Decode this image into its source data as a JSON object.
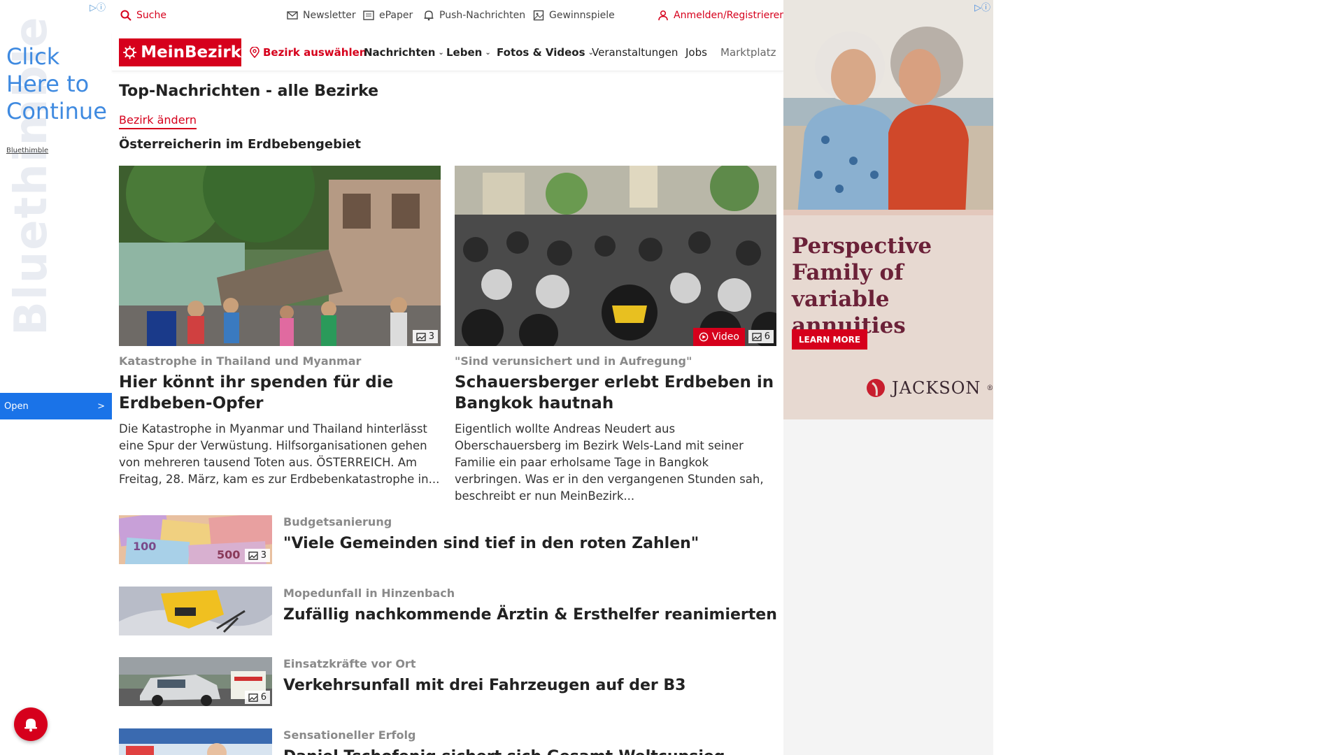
{
  "left_ad": {
    "bg_brand": "Bluethimble",
    "cta_lines": [
      "Click",
      "Here to",
      "Continue"
    ],
    "brand": "Bluethimble",
    "open_label": "Open",
    "open_chevron": ">"
  },
  "topbar": {
    "search": "Suche",
    "newsletter": "Newsletter",
    "epaper": "ePaper",
    "push": "Push-Nachrichten",
    "gewinnspiele": "Gewinnspiele",
    "login": "Anmelden/Registrieren"
  },
  "nav": {
    "logo": "MeinBezirk",
    "bezirk": "Bezirk auswählen",
    "items": [
      "Nachrichten",
      "Leben",
      "Fotos & Videos",
      "Veranstaltungen",
      "Jobs",
      "Marktplatz"
    ]
  },
  "main": {
    "title": "Top-Nachrichten - alle Bezirke",
    "change_link": "Bezirk ändern",
    "section": "Österreicherin im Erdbebengebiet",
    "cards": [
      {
        "kicker": "Katastrophe in Thailand und Myanmar",
        "headline": "Hier könnt ihr spenden für die Erdbeben-Opfer",
        "teaser": "Die Katastrophe in Myanmar und Thailand hinterlässt eine Spur der Verwüstung. Hilfsorganisationen gehen von mehreren tausend Toten aus.  ÖSTERREICH. Am Freitag, 28. März, kam es zur Erdbebenkatastrophe in...",
        "photo_count": "3"
      },
      {
        "kicker": "\"Sind verunsichert und in Aufregung\"",
        "headline": "Schauersberger erlebt Erdbeben in Bangkok hautnah",
        "teaser": "Eigentlich wollte Andreas Neudert aus Oberschauersberg im Bezirk Wels-Land mit seiner Familie ein paar erholsame Tage in Bangkok verbringen. Was er in den vergangenen Stunden sah, beschreibt er nun MeinBezirk...",
        "video_label": "Video",
        "photo_count": "6"
      }
    ],
    "list": [
      {
        "kicker": "Budgetsanierung",
        "headline": "\"Viele Gemeinden sind tief in den roten Zahlen\"",
        "photo_count": "3"
      },
      {
        "kicker": "Mopedunfall in Hinzenbach",
        "headline": "Zufällig nachkommende Ärztin & Ersthelfer reanimierten"
      },
      {
        "kicker": "Einsatzkräfte vor Ort",
        "headline": "Verkehrsunfall mit drei Fahrzeugen auf der B3",
        "photo_count": "6"
      },
      {
        "kicker": "Sensationeller Erfolg",
        "headline": "Daniel Tschofenig sichert sich Gesamt-Weltcupsieg"
      }
    ]
  },
  "right_ad": {
    "tagline_lines": [
      "Perspective",
      "Family of variable",
      "annuities"
    ],
    "cta": "LEARN MORE",
    "brand": "JACKSON",
    "reg": "®"
  },
  "colors": {
    "brand_red": "#d6001c",
    "ad_blue": "#1a73e8",
    "ad_text_blue": "#3f8ae0"
  }
}
